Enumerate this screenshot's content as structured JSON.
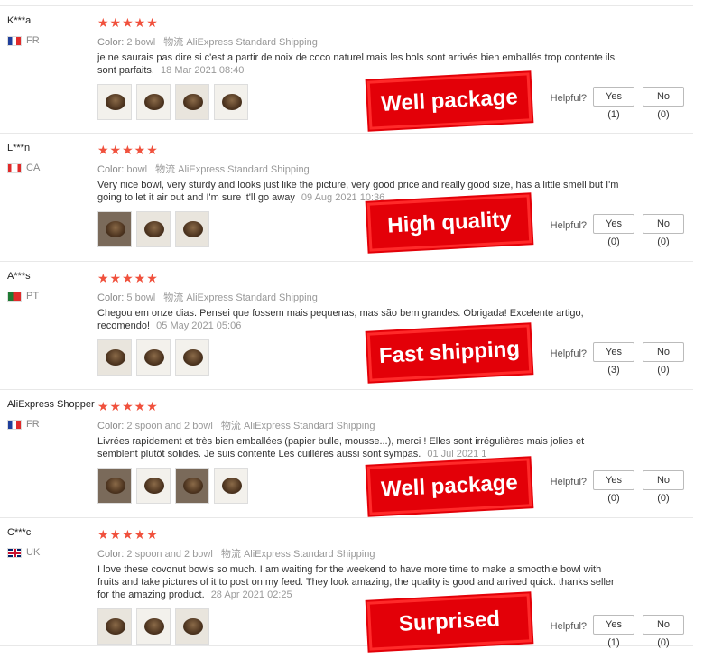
{
  "reviews": [
    {
      "user": "K***a",
      "country_code": "FR",
      "flag": "fr-flag-icon",
      "stars": "★★★★★",
      "color_label": "Color:",
      "color_value": "2 bowl",
      "shipping_label": "物流",
      "shipping_value": "AliExpress Standard Shipping",
      "text": "je ne saurais pas dire si c'est a partir de noix de coco naturel mais les bols sont arrivés bien emballés trop contente ils sont parfaits.",
      "date": "18 Mar 2021 08:40",
      "helpful": "Helpful?",
      "yes": "Yes (1)",
      "no": "No (0)",
      "stamp": "Well package",
      "thumb_count": 4
    },
    {
      "user": "L***n",
      "country_code": "CA",
      "flag": "ca-flag-icon",
      "stars": "★★★★★",
      "color_label": "Color:",
      "color_value": "bowl",
      "shipping_label": "物流",
      "shipping_value": "AliExpress Standard Shipping",
      "text": "Very nice bowl, very sturdy and looks just like the picture, very good price and really good size, has a little smell but I'm going to let it air out and I'm sure it'll go away",
      "date": "09 Aug 2021 10:36",
      "helpful": "Helpful?",
      "yes": "Yes (0)",
      "no": "No (0)",
      "stamp": "High quality",
      "thumb_count": 3
    },
    {
      "user": "A***s",
      "country_code": "PT",
      "flag": "pt-flag-icon",
      "stars": "★★★★★",
      "color_label": "Color:",
      "color_value": "5 bowl",
      "shipping_label": "物流",
      "shipping_value": "AliExpress Standard Shipping",
      "text": "Chegou em onze dias. Pensei que fossem mais pequenas, mas são bem grandes. Obrigada! Excelente artigo, recomendo!",
      "date": "05 May 2021 05:06",
      "helpful": "Helpful?",
      "yes": "Yes (3)",
      "no": "No (0)",
      "stamp": "Fast shipping",
      "thumb_count": 3
    },
    {
      "user": "AliExpress Shopper",
      "country_code": "FR",
      "flag": "fr-flag-icon",
      "stars": "★★★★★",
      "color_label": "Color:",
      "color_value": "2 spoon and 2 bowl",
      "shipping_label": "物流",
      "shipping_value": "AliExpress Standard Shipping",
      "text": "Livrées rapidement et très bien emballées (papier bulle, mousse...), merci ! Elles sont irrégulières mais jolies et semblent plutôt solides. Je suis contente Les cuillères aussi sont sympas.",
      "date": "01 Jul 2021 1",
      "helpful": "Helpful?",
      "yes": "Yes (0)",
      "no": "No (0)",
      "stamp": "Well package",
      "thumb_count": 4
    },
    {
      "user": "C***c",
      "country_code": "UK",
      "flag": "uk-flag-icon",
      "stars": "★★★★★",
      "color_label": "Color:",
      "color_value": "2 spoon and 2 bowl",
      "shipping_label": "物流",
      "shipping_value": "AliExpress Standard Shipping",
      "text": "I love these covonut bowls so much. I am waiting for the weekend to have more time to make a smoothie bowl with fruits and take pictures of it to post on my feed. They look amazing, the quality is good and arrived quick. thanks seller for the amazing product.",
      "date": "28 Apr 2021 02:25",
      "helpful": "Helpful?",
      "yes": "Yes (1)",
      "no": "No (0)",
      "stamp": "Surprised",
      "thumb_count": 3
    }
  ],
  "colors": {
    "star": "#f0513d",
    "stamp": "#e30008"
  }
}
